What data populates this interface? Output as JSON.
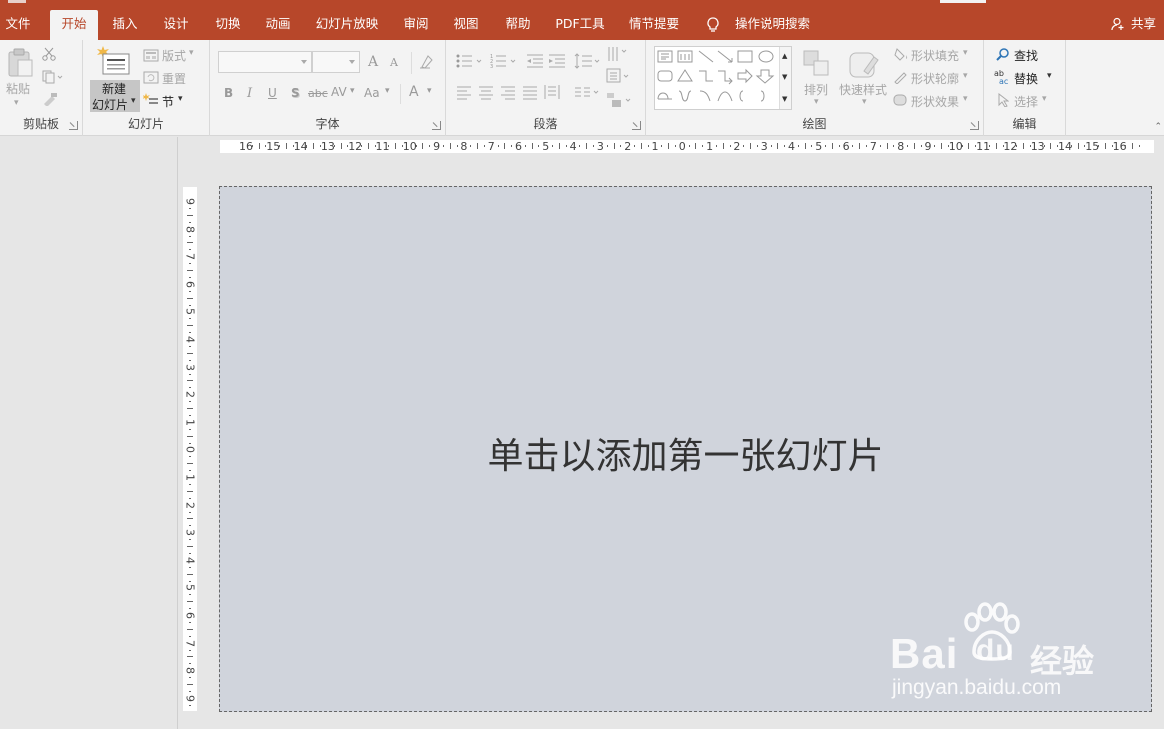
{
  "menu": {
    "tabs": [
      {
        "label": "文件"
      },
      {
        "label": "开始"
      },
      {
        "label": "插入"
      },
      {
        "label": "设计"
      },
      {
        "label": "切换"
      },
      {
        "label": "动画"
      },
      {
        "label": "幻灯片放映"
      },
      {
        "label": "审阅"
      },
      {
        "label": "视图"
      },
      {
        "label": "帮助"
      },
      {
        "label": "PDF工具"
      },
      {
        "label": "情节提要"
      }
    ],
    "active_tab": "开始",
    "tell_me": "操作说明搜索",
    "share": "共享",
    "accent": "#b7472a"
  },
  "ribbon": {
    "clipboard": {
      "label": "剪贴板",
      "paste": "粘贴"
    },
    "slides": {
      "label": "幻灯片",
      "new_slide_line1": "新建",
      "new_slide_line2": "幻灯片",
      "layout": "版式",
      "reset": "重置",
      "section": "节"
    },
    "font": {
      "label": "字体",
      "bold": "B",
      "italic": "I",
      "underline": "U",
      "shadow": "S",
      "strike": "abc",
      "spacing": "AV",
      "case": "Aa",
      "color": "A",
      "grow": "A",
      "shrink": "A"
    },
    "paragraph": {
      "label": "段落"
    },
    "drawing": {
      "label": "绘图",
      "arrange": "排列",
      "quick_styles": "快速样式",
      "fill": "形状填充",
      "outline": "形状轮廓",
      "effects": "形状效果"
    },
    "editing": {
      "label": "编辑",
      "find": "查找",
      "replace": "替换",
      "select": "选择"
    }
  },
  "rulers": {
    "horizontal": [
      "16",
      "15",
      "14",
      "13",
      "12",
      "11",
      "10",
      "9",
      "8",
      "7",
      "6",
      "5",
      "4",
      "3",
      "2",
      "1",
      "0",
      "1",
      "2",
      "3",
      "4",
      "5",
      "6",
      "7",
      "8",
      "9",
      "10",
      "11",
      "12",
      "13",
      "14",
      "15",
      "16"
    ],
    "vertical": [
      "9",
      "8",
      "7",
      "6",
      "5",
      "4",
      "3",
      "2",
      "1",
      "0",
      "1",
      "2",
      "3",
      "4",
      "5",
      "6",
      "7",
      "8",
      "9"
    ]
  },
  "slide": {
    "hint": "单击以添加第一张幻灯片",
    "bg_color": "#d0d4dc"
  },
  "watermark": {
    "brand": "Bai",
    "brand2": "du",
    "cn": "经验",
    "url": "jingyan.baidu.com"
  }
}
